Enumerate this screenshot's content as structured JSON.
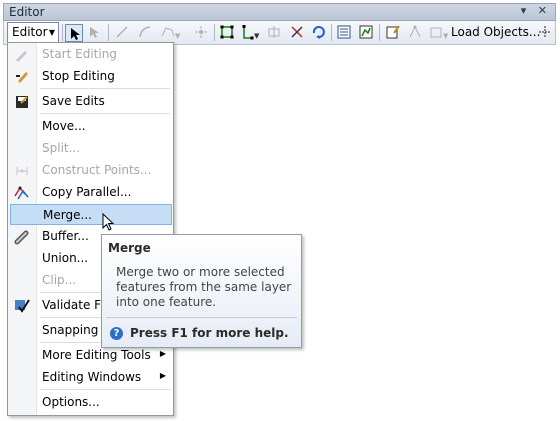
{
  "window": {
    "title": "Editor",
    "controls": "▾ ✕"
  },
  "toolbar": {
    "editor_label": "Editor",
    "load_objects_label": "Load Objects..."
  },
  "menu": {
    "items": [
      {
        "label": "Start Editing",
        "disabled": true,
        "icon": "pencil-disabled-icon"
      },
      {
        "label": "Stop Editing",
        "disabled": false,
        "icon": "stop-editing-pencil-icon"
      },
      {
        "label": "Save Edits",
        "disabled": false,
        "icon": "save-edits-icon"
      },
      {
        "label": "Move...",
        "disabled": false
      },
      {
        "label": "Split...",
        "disabled": true
      },
      {
        "label": "Construct Points...",
        "disabled": true,
        "icon": "construct-points-icon"
      },
      {
        "label": "Copy Parallel...",
        "disabled": false,
        "icon": "copy-parallel-icon"
      },
      {
        "label": "Merge...",
        "disabled": false,
        "selected": true
      },
      {
        "label": "Buffer...",
        "disabled": false,
        "icon": "buffer-icon"
      },
      {
        "label": "Union...",
        "disabled": false
      },
      {
        "label": "Clip...",
        "disabled": true
      },
      {
        "label": "Validate Fea",
        "disabled": false,
        "icon": "validate-features-icon"
      },
      {
        "label": "Snapping",
        "disabled": false
      },
      {
        "label": "More Editing Tools",
        "disabled": false,
        "submenu": true
      },
      {
        "label": "Editing Windows",
        "disabled": false,
        "submenu": true
      },
      {
        "label": "Options...",
        "disabled": false
      }
    ]
  },
  "tooltip": {
    "title": "Merge",
    "body": "Merge two or more selected features from the same layer into one feature.",
    "help": "Press F1 for more help."
  },
  "colors": {
    "selection": "#c5ddf5",
    "selection_border": "#7fb2e6",
    "disabled_text": "#a6a6a6"
  }
}
